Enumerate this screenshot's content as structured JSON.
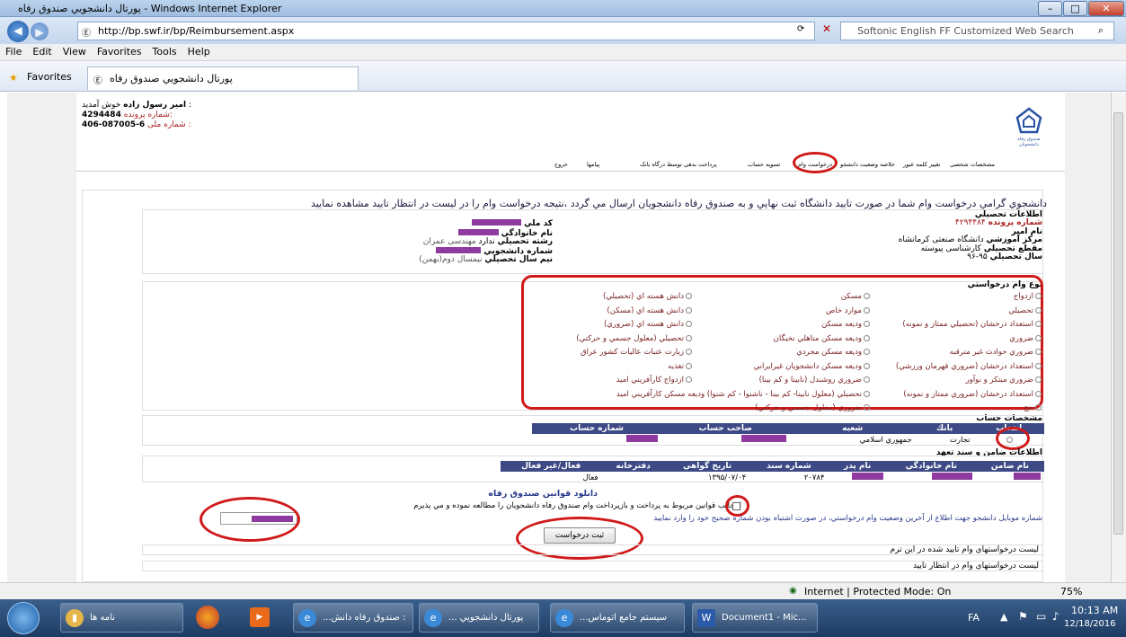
{
  "window": {
    "title": "پورتال دانشجويي صندوق رفاه - Windows Internet Explorer",
    "minimize": "–",
    "maximize": "□",
    "close": "✕"
  },
  "address": {
    "url": "http://bp.swf.ir/bp/Reimbursement.aspx",
    "search_placeholder": "Softonic English FF Customized Web Search"
  },
  "menu": [
    "File",
    "Edit",
    "View",
    "Favorites",
    "Tools",
    "Help"
  ],
  "favorites": {
    "label": "Favorites",
    "tab": "پورتال دانشجويي صندوق رفاه"
  },
  "user": {
    "welcome_label": "خوش آمديد :",
    "welcome_name": "امير رسول زاده",
    "file_label": "شماره پرونده:",
    "file_no": "4294484",
    "national_label": "شماره ملی :",
    "national_no": "406-087005-6"
  },
  "logo": {
    "caption": "صندوق رفاه دانشجویان"
  },
  "nav_tabs": [
    "مشخصات شخصی",
    "تغییر کلمه عبور",
    "خلاصه وضعیت دانشجو",
    "درخواست وام",
    "تسویه حساب",
    "پرداخت بدهی توسط درگاه بانک",
    "پیامها",
    "خروج"
  ],
  "notice": "دانشجوي گرامي درخواست وام شما در صورت تاييد دانشگاه ثبت نهايي و به صندوق رفاه دانشجويان ارسال مي گردد ،نتيجه درخواست وام را در ليست در انتظار تاييد مشاهده نماييد",
  "edu": {
    "section": "اطلاعات تحصيلي",
    "file_label": "شماره پرونده",
    "file_value": "۴۲۹۴۴۸۴",
    "uni_label": "نام امير",
    "center_label": "مركز آموزشي",
    "center_value": "دانشگاه صنعتی کرمانشاه",
    "grade_label": "مقطع تحصيلي",
    "grade_value": "کارشناسی پیوسته",
    "year_label": "سال تحصيلي",
    "year_value": "۹۵-۹۶",
    "national_label": "كد ملي",
    "family_label": "نام خانوادگي",
    "field_label": "رشته تحصيلي",
    "field_value": "مهندسی عمران",
    "field_prefix": "ندارد",
    "student_no_label": "شماره دانشجويي",
    "semester_label": "نيم سال تحصيلي",
    "semester_value": "نيمسال دوم(بهمن)"
  },
  "loan_types": {
    "section": "نوع وام درخواستي",
    "col1": [
      "ازدواج",
      "تحصيلي",
      "استعداد درخشان (تحصيلي ممتاز و نمونه)",
      "ضروري",
      "ضروري حوادث غير مترقبه",
      "استعداد درخشان (ضروري قهرمان ورزشي)",
      "ضروري مبتكر و نوآور",
      "استعداد درخشان (ضروري ممتاز و نمونه)",
      "حج"
    ],
    "col2": [
      "مسكن",
      "موارد خاص",
      "وديعه مسكن",
      "وديعه مسكن متاهلي نخبگان",
      "وديعه مسكن مجردي",
      "وديعه مسكن دانشجويان غيرايراني",
      "ضروري روشندل (نابينا و كم بينا)",
      "تحصيلي (معلول نابينا- كم بينا - ناشنوا - كم شنوا) وديعه مسكن كارآفريني اميد",
      "ضروري (معلول جسمي و حركتي)"
    ],
    "col3": [
      "دانش هسته اي (تحصيلي)",
      "دانش هسته اي (مسكن)",
      "دانش هسته اي (ضروري)",
      "تحصيلي (معلول جسمي و حركتي)",
      "زيارت عتبات عاليات كشور عراق",
      "تغذيه",
      "ازدواج كارآفريني اميد"
    ]
  },
  "account": {
    "section": "مشخصات حساب",
    "headers": [
      "انتخاب",
      "بانك",
      "شعبه",
      "صاحب حساب",
      "شماره حساب"
    ],
    "row": {
      "bank": "تجارت",
      "branch": "جمهوري اسلامي"
    }
  },
  "guarantor": {
    "section": "اطلاعات ضامن و سند تعهد",
    "headers": [
      "نام ضامن",
      "نام خانوادگي",
      "نام پدر",
      "شماره سند",
      "تاريخ گواهي",
      "دفترخانه",
      "فعال/غير فعال"
    ],
    "row": {
      "doc_no": "۲۰۷۸۴",
      "date": "۱۳۹۵/۰۷/۰۴",
      "status": "فعال"
    }
  },
  "rules": {
    "title": "دانلود قوانين صندوق رفاه",
    "agree": "اينجانب قوانين مربوط به پرداخت و بازپرداخت وام صندوق رفاه دانشجويان را مطالعه نموده و مي پذيرم",
    "mobile_note": "شماره موبايل دانشجو جهت اطلاع از آخرين وضعيت وام درخواستي، در صورت اشتباه بودن شماره صحيح خود را وارد نماييد"
  },
  "submit": "ثبت درخواست",
  "lists": [
    "ليست درخواستهاي وام تاييد شده در اين ترم",
    "ليست درخواستهاي وام در انتظار تاييد"
  ],
  "statusbar": {
    "zone": "Internet | Protected Mode: On",
    "zoom": "75%"
  },
  "taskbar": {
    "items": [
      "نامه ها",
      "...صندوق رفاه دانش :",
      "... پورتال دانشجويي",
      "...سيستم جامع اتوماس",
      "Document1 - Mic..."
    ],
    "lang": "FA",
    "time": "10:13 AM",
    "date": "12/18/2016"
  }
}
